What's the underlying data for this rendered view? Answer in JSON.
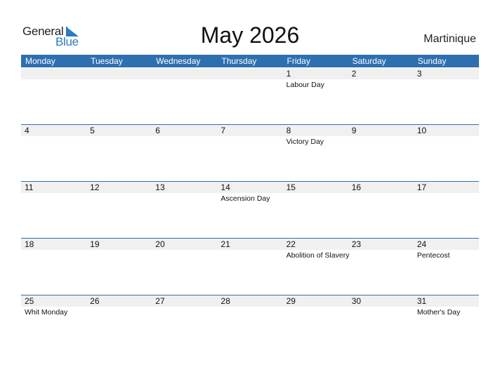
{
  "logo": {
    "line1": "General",
    "line2": "Blue"
  },
  "title": "May 2026",
  "country": "Martinique",
  "colors": {
    "accent": "#2e6fb0",
    "logo_blue": "#2a7bc4",
    "date_band": "#f0f0f0"
  },
  "weekdays": [
    "Monday",
    "Tuesday",
    "Wednesday",
    "Thursday",
    "Friday",
    "Saturday",
    "Sunday"
  ],
  "weeks": [
    [
      {
        "day": "",
        "holiday": ""
      },
      {
        "day": "",
        "holiday": ""
      },
      {
        "day": "",
        "holiday": ""
      },
      {
        "day": "",
        "holiday": ""
      },
      {
        "day": "1",
        "holiday": "Labour Day"
      },
      {
        "day": "2",
        "holiday": ""
      },
      {
        "day": "3",
        "holiday": ""
      }
    ],
    [
      {
        "day": "4",
        "holiday": ""
      },
      {
        "day": "5",
        "holiday": ""
      },
      {
        "day": "6",
        "holiday": ""
      },
      {
        "day": "7",
        "holiday": ""
      },
      {
        "day": "8",
        "holiday": "Victory Day"
      },
      {
        "day": "9",
        "holiday": ""
      },
      {
        "day": "10",
        "holiday": ""
      }
    ],
    [
      {
        "day": "11",
        "holiday": ""
      },
      {
        "day": "12",
        "holiday": ""
      },
      {
        "day": "13",
        "holiday": ""
      },
      {
        "day": "14",
        "holiday": "Ascension Day"
      },
      {
        "day": "15",
        "holiday": ""
      },
      {
        "day": "16",
        "holiday": ""
      },
      {
        "day": "17",
        "holiday": ""
      }
    ],
    [
      {
        "day": "18",
        "holiday": ""
      },
      {
        "day": "19",
        "holiday": ""
      },
      {
        "day": "20",
        "holiday": ""
      },
      {
        "day": "21",
        "holiday": ""
      },
      {
        "day": "22",
        "holiday": "Abolition of Slavery"
      },
      {
        "day": "23",
        "holiday": ""
      },
      {
        "day": "24",
        "holiday": "Pentecost"
      }
    ],
    [
      {
        "day": "25",
        "holiday": "Whit Monday"
      },
      {
        "day": "26",
        "holiday": ""
      },
      {
        "day": "27",
        "holiday": ""
      },
      {
        "day": "28",
        "holiday": ""
      },
      {
        "day": "29",
        "holiday": ""
      },
      {
        "day": "30",
        "holiday": ""
      },
      {
        "day": "31",
        "holiday": "Mother's Day"
      }
    ]
  ]
}
